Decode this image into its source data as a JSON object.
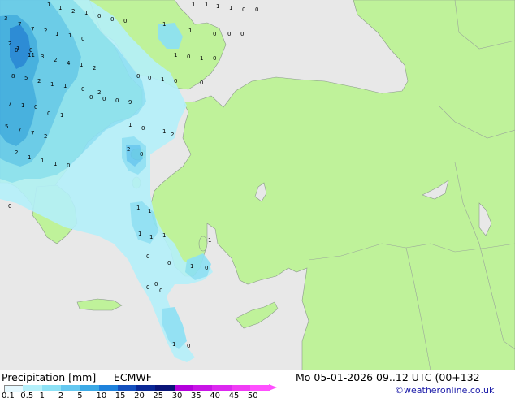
{
  "legend": {
    "title": "Precipitation [mm]",
    "model": "ECMWF",
    "timestamp": "Mo 05-01-2026 09..12 UTC (00+132",
    "credit": "©weatheronline.co.uk",
    "scale": [
      {
        "label": "0.1",
        "color": "#e6f9ff"
      },
      {
        "label": "0.5",
        "color": "#b4f0fa"
      },
      {
        "label": "1",
        "color": "#8ce1f5"
      },
      {
        "label": "2",
        "color": "#64c8f0"
      },
      {
        "label": "5",
        "color": "#3caae6"
      },
      {
        "label": "10",
        "color": "#1e82dc"
      },
      {
        "label": "15",
        "color": "#1450be"
      },
      {
        "label": "20",
        "color": "#0a2896"
      },
      {
        "label": "25",
        "color": "#0a1478"
      },
      {
        "label": "30",
        "color": "#b400dc"
      },
      {
        "label": "35",
        "color": "#c814e6"
      },
      {
        "label": "40",
        "color": "#dc28f0"
      },
      {
        "label": "45",
        "color": "#f03cf5"
      },
      {
        "label": "50",
        "color": "#ff50ff"
      }
    ]
  },
  "map": {
    "land_color": "#bff29a",
    "sea_color": "#e8e8e8",
    "precip_values": [
      "3",
      "1",
      "1",
      "2",
      "1",
      "0",
      "0",
      "0",
      "1",
      "1",
      "1",
      "1",
      "1",
      "0",
      "0",
      "7",
      "7",
      "2",
      "1",
      "1",
      "0",
      "1",
      "0",
      "0",
      "0",
      "2",
      "1",
      "0",
      "0",
      "11",
      "3",
      "2",
      "4",
      "1",
      "2",
      "1",
      "0",
      "1",
      "0",
      "8",
      "5",
      "2",
      "1",
      "1",
      "0",
      "2",
      "0",
      "0",
      "1",
      "0",
      "0",
      "0",
      "0",
      "0",
      "9",
      "7",
      "1",
      "0",
      "0",
      "1",
      "5",
      "7",
      "7",
      "2",
      "1",
      "0",
      "1",
      "2",
      "2",
      "1",
      "1",
      "1",
      "0",
      "2",
      "0",
      "1",
      "1",
      "1",
      "1",
      "1",
      "0",
      "0",
      "1",
      "0",
      "0",
      "0",
      "0",
      "1",
      "0",
      "1",
      "0"
    ]
  }
}
